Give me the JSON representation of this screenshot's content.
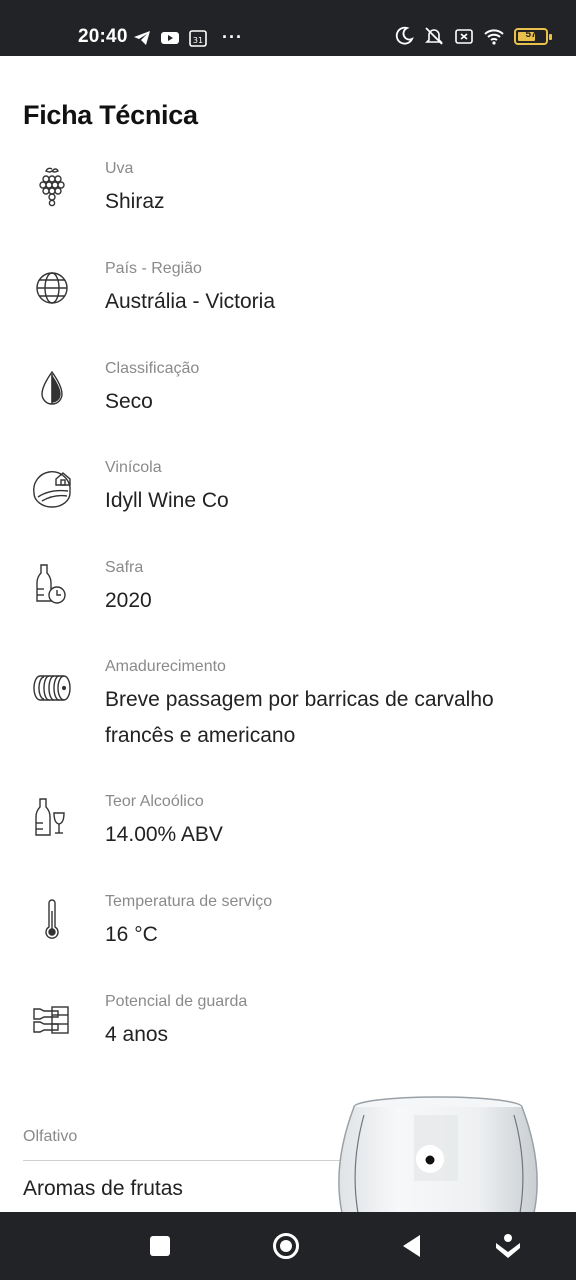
{
  "status_bar": {
    "time": "20:40",
    "calendar_day": "31",
    "more": "···",
    "battery_level": "57",
    "icons": [
      "telegram-icon",
      "youtube-icon",
      "calendar-icon",
      "moon-icon",
      "mute-icon",
      "sim-x-icon",
      "wifi-icon",
      "battery-icon"
    ]
  },
  "page": {
    "title": "Ficha Técnica"
  },
  "specs": [
    {
      "label": "Uva",
      "value": "Shiraz",
      "icon": "grape-icon"
    },
    {
      "label": "País - Região",
      "value": "Austrália - Victoria",
      "icon": "globe-icon"
    },
    {
      "label": "Classificação",
      "value": "Seco",
      "icon": "drop-icon"
    },
    {
      "label": "Vinícola",
      "value": "Idyll Wine Co",
      "icon": "winery-icon"
    },
    {
      "label": "Safra",
      "value": "2020",
      "icon": "bottle-clock-icon"
    },
    {
      "label": "Amadurecimento",
      "value_line1": "Breve passagem por barricas de carvalho",
      "value_line2": "francês e americano",
      "icon": "barrel-icon"
    },
    {
      "label": "Teor Alcoólico",
      "value": "14.00% ABV",
      "icon": "bottle-glass-icon"
    },
    {
      "label": "Temperatura de serviço",
      "value": "16 °C",
      "icon": "thermometer-icon"
    },
    {
      "label": "Potencial de guarda",
      "value": "4 anos",
      "icon": "bottles-rack-icon"
    }
  ],
  "olfativo": {
    "label": "Olfativo",
    "text": "Aromas de frutas"
  },
  "nav_bar": {
    "buttons": [
      "recents-button",
      "home-button",
      "back-button",
      "assist-button"
    ]
  },
  "colors": {
    "bars": "#222326",
    "battery": "#e8c04a",
    "label_gray": "#8a8a8a"
  }
}
